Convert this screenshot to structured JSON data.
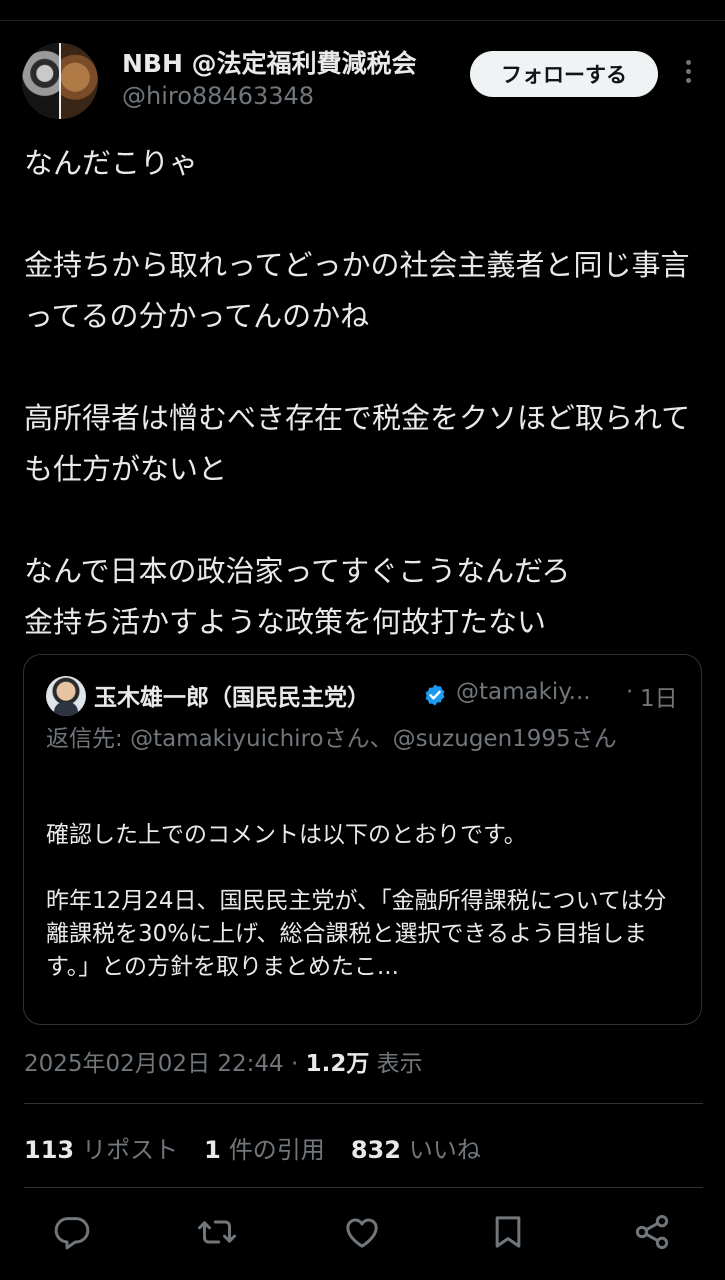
{
  "author": {
    "display_name": "NBH @法定福利費減税会",
    "handle": "@hiro88463348",
    "follow_label": "フォローする"
  },
  "post": {
    "text": "なんだこりゃ\n\n金持ちから取れってどっかの社会主義者と同じ事言ってるの分かってんのかね\n\n高所得者は憎むべき存在で税金をクソほど取られても仕方がないと\n\nなんで日本の政治家ってすぐこうなんだろ\n金持ち活かすような政策を何故打たない"
  },
  "quote": {
    "display_name": "玉木雄一郎（国民民主党）",
    "handle": "@tamakiy...",
    "dot": "·",
    "time": "1日",
    "reply_prefix": "返信先: ",
    "reply_user1": "@tamakiyuichiro",
    "reply_mid": "さん、",
    "reply_user2": "@suzugen1995",
    "reply_suffix": "さん",
    "text": "確認した上でのコメントは以下のとおりです。\n\n昨年12月24日、国民民主党が、「金融所得課税については分離課税を30%に上げ、総合課税と選択できるよう目指します。」との方針を取りまとめたこ..."
  },
  "meta": {
    "datetime": "2025年02月02日 22:44",
    "dot": " · ",
    "views": "1.2万",
    "views_label": " 表示"
  },
  "stats": {
    "reposts": "113",
    "reposts_label": "リポスト",
    "quotes": "1",
    "quotes_label": "件の引用",
    "likes": "832",
    "likes_label": "いいね"
  },
  "actions": [
    "reply-icon",
    "repost-icon",
    "like-icon",
    "bookmark-icon",
    "share-icon"
  ],
  "colors": {
    "background": "#000000",
    "text": "#e7e9ea",
    "muted": "#71767b",
    "verified": "#1d9bf0",
    "border": "#2f3336"
  }
}
